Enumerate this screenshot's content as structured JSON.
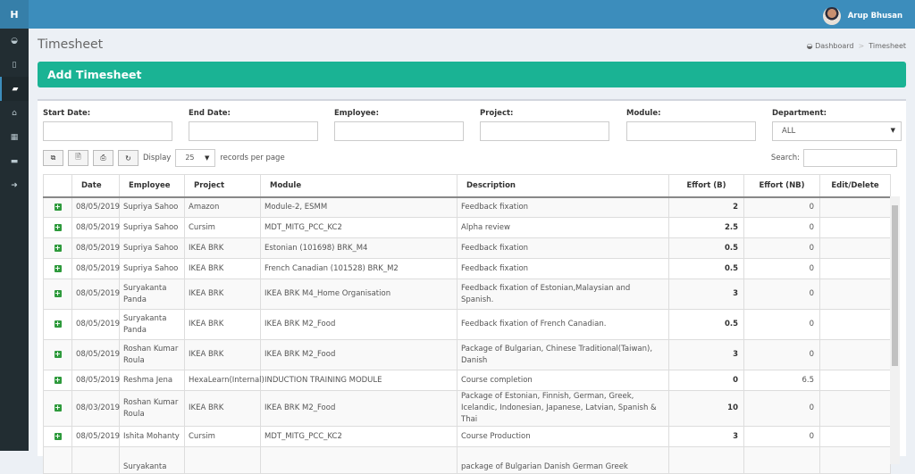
{
  "header": {
    "logo": "H",
    "user_name": "Arup Bhusan"
  },
  "sidebar": {
    "items": [
      {
        "icon": "dashboard-icon",
        "glyph": "◒"
      },
      {
        "icon": "file-icon",
        "glyph": "▯"
      },
      {
        "icon": "book-icon",
        "glyph": "▰",
        "active": true
      },
      {
        "icon": "bank-icon",
        "glyph": "⌂"
      },
      {
        "icon": "grid-icon",
        "glyph": "▦"
      },
      {
        "icon": "folder-icon",
        "glyph": "▬"
      },
      {
        "icon": "sign-out-icon",
        "glyph": "➜"
      }
    ]
  },
  "page": {
    "title": "Timesheet",
    "breadcrumb": [
      "Dashboard",
      "Timesheet"
    ],
    "add_button": "Add Timesheet"
  },
  "filters": {
    "start_date": "Start Date:",
    "end_date": "End Date:",
    "employee": "Employee:",
    "project": "Project:",
    "module": "Module:",
    "department": "Department:",
    "department_value": "ALL"
  },
  "toolbar": {
    "display": "Display",
    "page_size": "25",
    "records_per_page": "records per page",
    "search": "Search:"
  },
  "table": {
    "headers": [
      "",
      "Date",
      "Employee",
      "Project",
      "Module",
      "Description",
      "Effort (B)",
      "Effort (NB)",
      "Edit/Delete"
    ],
    "rows": [
      [
        "08/05/2019",
        "Supriya Sahoo",
        "Amazon",
        "Module-2, ESMM",
        "Feedback fixation",
        "2",
        "0"
      ],
      [
        "08/05/2019",
        "Supriya Sahoo",
        "Cursim",
        "MDT_MITG_PCC_KC2",
        "Alpha review",
        "2.5",
        "0"
      ],
      [
        "08/05/2019",
        "Supriya Sahoo",
        "IKEA BRK",
        "Estonian (101698) BRK_M4",
        "Feedback fixation",
        "0.5",
        "0"
      ],
      [
        "08/05/2019",
        "Supriya Sahoo",
        "IKEA BRK",
        "French Canadian (101528) BRK_M2",
        "Feedback fixation",
        "0.5",
        "0"
      ],
      [
        "08/05/2019",
        "Suryakanta Panda",
        "IKEA BRK",
        "IKEA BRK M4_Home Organisation",
        "Feedback fixation of Estonian,Malaysian and Spanish.",
        "3",
        "0"
      ],
      [
        "08/05/2019",
        "Suryakanta Panda",
        "IKEA BRK",
        "IKEA BRK M2_Food",
        "Feedback fixation of French Canadian.",
        "0.5",
        "0"
      ],
      [
        "08/05/2019",
        "Roshan Kumar Roula",
        "IKEA BRK",
        "IKEA BRK M2_Food",
        "Package of Bulgarian, Chinese Traditional(Taiwan), Danish",
        "3",
        "0"
      ],
      [
        "08/05/2019",
        "Reshma Jena",
        "HexaLearn(Internal)",
        "INDUCTION TRAINING MODULE",
        "Course completion",
        "0",
        "6.5"
      ],
      [
        "08/03/2019",
        "Roshan Kumar Roula",
        "IKEA BRK",
        "IKEA BRK M2_Food",
        "Package of Estonian, Finnish, German, Greek, Icelandic, Indonesian, Japanese, Latvian, Spanish & Thai",
        "10",
        "0"
      ],
      [
        "08/05/2019",
        "Ishita Mohanty",
        "Cursim",
        "MDT_MITG_PCC_KC2",
        "Course Production",
        "3",
        "0"
      ],
      [
        "",
        "Suryakanta",
        "",
        "",
        "package of Bulgarian Danish German Greek",
        "",
        ""
      ]
    ]
  }
}
